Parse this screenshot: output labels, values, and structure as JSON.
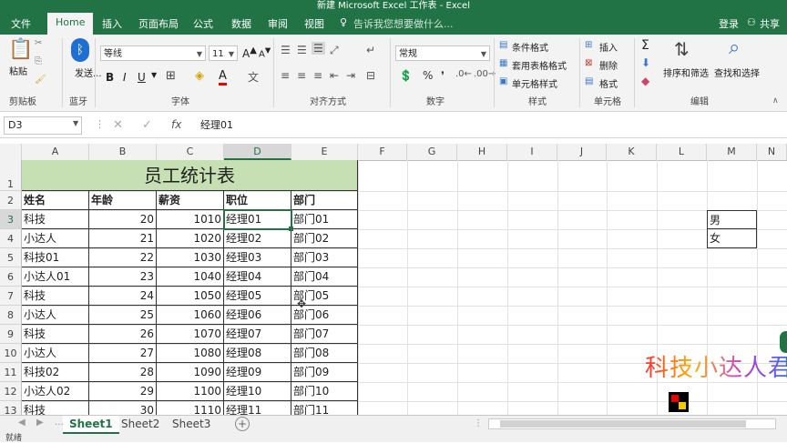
{
  "window": {
    "title": "新建 Microsoft Excel 工作表 - Excel"
  },
  "menu": {
    "tabs": [
      "文件",
      "Home",
      "插入",
      "页面布局",
      "公式",
      "数据",
      "审阅",
      "视图"
    ],
    "tell_me": "告诉我您想要做什么...",
    "login": "登录",
    "share": "共享"
  },
  "ribbon": {
    "paste": "粘贴",
    "send": "发送...",
    "font_name": "等线",
    "font_size": "11",
    "bold": "B",
    "italic": "I",
    "underline": "U",
    "number_format": "常规",
    "percent": "%",
    "conditional_format": "条件格式",
    "table_format": "套用表格格式",
    "cell_style": "单元格样式",
    "insert": "插入",
    "delete": "删除",
    "format": "格式",
    "sort_filter": "排序和筛选",
    "find_select": "查找和选择",
    "groups": [
      "剪贴板",
      "蓝牙",
      "字体",
      "对齐方式",
      "数字",
      "样式",
      "单元格",
      "编辑"
    ]
  },
  "formula_bar": {
    "cell_ref": "D3",
    "fx": "fx",
    "content": "经理01"
  },
  "columns": [
    "A",
    "B",
    "C",
    "D",
    "E",
    "F",
    "G",
    "H",
    "I",
    "J",
    "K",
    "L",
    "M",
    "N"
  ],
  "rows": [
    "1",
    "2",
    "3",
    "4",
    "5",
    "6",
    "7",
    "8",
    "9",
    "10",
    "11",
    "12",
    "13"
  ],
  "sheet": {
    "title": "员工统计表",
    "headers": [
      "姓名",
      "年龄",
      "薪资",
      "职位",
      "部门"
    ],
    "data": [
      [
        "科技",
        "20",
        "1010",
        "经理01",
        "部门01"
      ],
      [
        "小达人",
        "21",
        "1020",
        "经理02",
        "部门02"
      ],
      [
        "科技01",
        "22",
        "1030",
        "经理03",
        "部门03"
      ],
      [
        "小达人01",
        "23",
        "1040",
        "经理04",
        "部门04"
      ],
      [
        "科技",
        "24",
        "1050",
        "经理05",
        "部门05"
      ],
      [
        "小达人",
        "25",
        "1060",
        "经理06",
        "部门06"
      ],
      [
        "科技",
        "26",
        "1070",
        "经理07",
        "部门07"
      ],
      [
        "小达人",
        "27",
        "1080",
        "经理08",
        "部门08"
      ],
      [
        "科技02",
        "28",
        "1090",
        "经理09",
        "部门09"
      ],
      [
        "小达人02",
        "29",
        "1100",
        "经理10",
        "部门10"
      ],
      [
        "科技",
        "30",
        "1110",
        "经理11",
        "部门11"
      ]
    ],
    "side_list": [
      "男",
      "女"
    ]
  },
  "sheet_tabs": [
    "Sheet1",
    "Sheet2",
    "Sheet3"
  ],
  "watermark": "科技小达人君",
  "status": {
    "ready": "就绪"
  },
  "colors": {
    "excel_green": "#217346",
    "title_fill": "#c6e0b4"
  }
}
